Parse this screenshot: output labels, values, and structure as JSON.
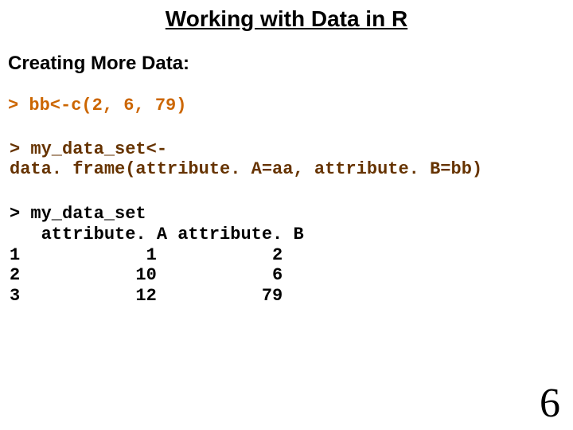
{
  "title": "Working with Data in R",
  "subtitle": "Creating More Data:",
  "code": {
    "block1": "> bb<-c(2, 6, 79)",
    "block2": "> my_data_set<-\ndata. frame(attribute. A=aa, attribute. B=bb)",
    "block3": "> my_data_set\n   attribute. A attribute. B\n1            1           2\n2           10           6\n3           12          79"
  },
  "page_number": "6",
  "chart_data": {
    "type": "table",
    "title": "my_data_set",
    "columns": [
      "",
      "attribute. A",
      "attribute. B"
    ],
    "rows": [
      [
        "1",
        1,
        2
      ],
      [
        "2",
        10,
        6
      ],
      [
        "3",
        12,
        79
      ]
    ]
  }
}
